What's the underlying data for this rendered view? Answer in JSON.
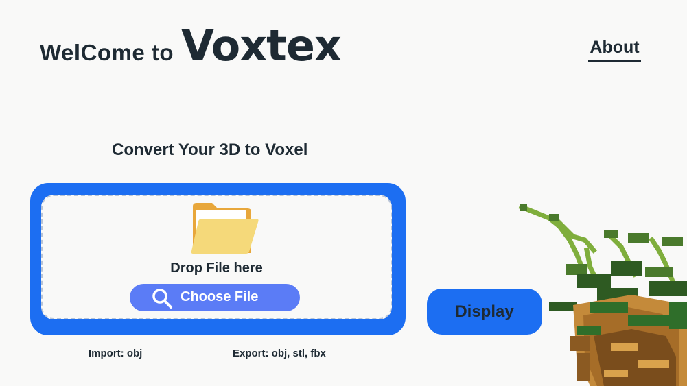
{
  "header": {
    "welcome_text": "WelCome to",
    "brand_name": "Voxtex",
    "about_link": "About"
  },
  "main": {
    "subtitle": "Convert Your 3D to Voxel",
    "dropzone": {
      "icon": "folder-icon",
      "drop_text": "Drop File here",
      "choose_button": {
        "icon": "search-icon",
        "label": "Choose File"
      }
    },
    "display_button": "Display",
    "import_text": "Import: obj",
    "export_text": "Export: obj, stl, fbx"
  },
  "decoration": {
    "image": "voxel-plant-image"
  },
  "colors": {
    "background": "#f9f9f8",
    "accent": "#1c6ef2",
    "choose_button": "#5b7cf6",
    "text": "#1e2a33",
    "folder_front": "#f5d97a",
    "folder_back": "#e8a73b"
  }
}
